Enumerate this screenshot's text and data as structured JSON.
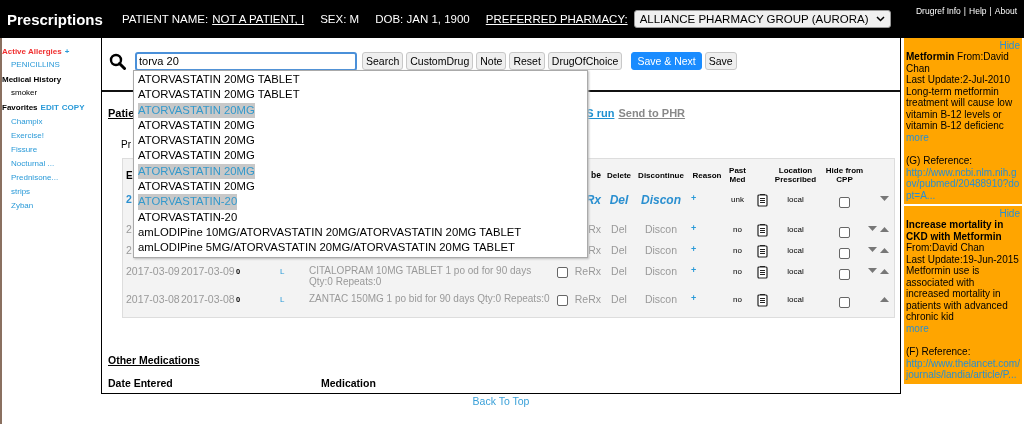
{
  "top_bar": {
    "title": "Prescriptions",
    "patient_label": "PATIENT NAME:",
    "patient_name": "NOT A PATIENT, I",
    "sex": "SEX: M",
    "dob": "DOB: JAN 1, 1900",
    "pharmacy_label": "PREFERRED PHARMACY:",
    "pharmacy": "ALLIANCE PHARMACY GROUP (AURORA)",
    "links": [
      {
        "label": "Drugref Info"
      },
      {
        "label": "Help"
      },
      {
        "label": "About"
      }
    ],
    "separator": "|"
  },
  "sidebar": {
    "allergies_title": "Active Allergies",
    "allergies_add": "+",
    "allergies": [
      "PENICILLINS"
    ],
    "history_title": "Medical History",
    "history": [
      "smoker"
    ],
    "favorites_title": "Favorites",
    "favorites_edit": "EDIT",
    "favorites_copy": "COPY",
    "favorites": [
      "Champix",
      "Exercise!",
      "Fissure",
      "Nocturnal ...",
      "Prednisone...",
      "strips",
      "Zyban"
    ]
  },
  "search": {
    "value": "torva 20",
    "buttons": [
      {
        "label": "Search",
        "kind": "plain"
      },
      {
        "label": "CustomDrug",
        "kind": "plain"
      },
      {
        "label": "Note",
        "kind": "plain"
      },
      {
        "label": "Reset",
        "kind": "plain"
      },
      {
        "label": "DrugOfChoice",
        "kind": "plain"
      },
      {
        "label": "Save & Next",
        "kind": "primary"
      },
      {
        "label": "Save",
        "kind": "plain"
      }
    ],
    "suggestions": [
      {
        "label": "ATORVASTATIN 20MG TABLET",
        "highlighted": false
      },
      {
        "label": "ATORVASTATIN 20MG TABLET",
        "highlighted": false
      },
      {
        "label": "ATORVASTATIN 20MG",
        "highlighted": true
      },
      {
        "label": "ATORVASTATIN 20MG",
        "highlighted": false
      },
      {
        "label": "ATORVASTATIN 20MG",
        "highlighted": false
      },
      {
        "label": "ATORVASTATIN 20MG",
        "highlighted": false
      },
      {
        "label": "ATORVASTATIN 20MG",
        "highlighted": true
      },
      {
        "label": "ATORVASTATIN 20MG",
        "highlighted": false
      },
      {
        "label": "ATORVASTATIN-20",
        "highlighted": true
      },
      {
        "label": "ATORVASTATIN-20",
        "highlighted": false
      },
      {
        "label": "amLODIPine 10MG/ATORVASTATIN 20MG/ATORVASTATIN 20MG TABLET",
        "highlighted": false
      },
      {
        "label": "amLODIPine 5MG/ATORVASTATIN 20MG/ATORVASTATIN 20MG TABLET",
        "highlighted": false
      }
    ]
  },
  "profile": {
    "heading": "Patie",
    "links": [
      {
        "label": "S run",
        "kind": "active"
      },
      {
        "label": "Send to PHR",
        "kind": "muted"
      }
    ],
    "note": "Pr",
    "table": {
      "columns": [
        "E",
        "be",
        "Delete",
        "Discontinue",
        "Reason",
        "Past Med",
        "Location Prescribed",
        "Hide from CPP"
      ],
      "rows": [
        {
          "current": true,
          "start": "2",
          "rerx": "Rx",
          "delete": "Del",
          "discontinue": "Discon",
          "reason": "+",
          "past_med": "unk",
          "location": "local",
          "hide_from_cpp": false,
          "down": true,
          "up": false
        },
        {
          "current": false,
          "start": "2",
          "rerx": "Rx",
          "delete": "Del",
          "discontinue": "Discon",
          "reason": "+",
          "past_med": "no",
          "location": "local",
          "hide_from_cpp": false,
          "down": true,
          "up": true
        },
        {
          "current": false,
          "start": "2",
          "rerx": "Rx",
          "delete": "Del",
          "discontinue": "Discon",
          "reason": "+",
          "past_med": "no",
          "location": "local",
          "hide_from_cpp": false,
          "down": true,
          "up": true
        },
        {
          "current": false,
          "start": "2017-03-09",
          "written": "2017-03-09",
          "days": "0",
          "flag": "L",
          "medication": "CITALOPRAM 10MG TABLET 1 po od for 90 days Qty:0 Repeats:0",
          "select_checked": false,
          "rerx": "ReRx",
          "delete": "Del",
          "discontinue": "Discon",
          "reason": "+",
          "past_med": "no",
          "location": "local",
          "hide_from_cpp": false,
          "down": true,
          "up": true
        },
        {
          "current": false,
          "start": "2017-03-08",
          "written": "2017-03-08",
          "days": "0",
          "flag": "L",
          "medication": "ZANTAC 150MG 1 po bid for 90 days Qty:0 Repeats:0",
          "select_checked": false,
          "rerx": "ReRx",
          "delete": "Del",
          "discontinue": "Discon",
          "reason": "+",
          "past_med": "no",
          "location": "local",
          "hide_from_cpp": false,
          "down": false,
          "up": true
        }
      ]
    },
    "other_heading": "Other Medications",
    "other_columns": [
      "Date Entered",
      "Medication"
    ]
  },
  "back_to_top": "Back To Top",
  "alerts": [
    {
      "hide": "Hide",
      "title": "Metformin",
      "from": "From:David Chan",
      "updated": "Last Update:2-Jul-2010",
      "body": "Long-term metformin treatment will cause low vitamin B-12 levels or vitamin B-12 deficienc",
      "more": "more",
      "reference": "(G)  Reference:",
      "url": "http://www.ncbi.nlm.nih.gov/pubmed/20488910?dopt=A..."
    },
    {
      "hide": "Hide",
      "title": "Increase mortality in CKD with Metformin",
      "from": "From:David Chan",
      "updated": "Last Update:19-Jun-2015",
      "body": "Metformin use is associated with increased mortality in patients with advanced chronic kid",
      "more": "more",
      "reference": "(F)  Reference:",
      "url": "http://www.thelancet.com/journals/landia/article/P..."
    }
  ]
}
